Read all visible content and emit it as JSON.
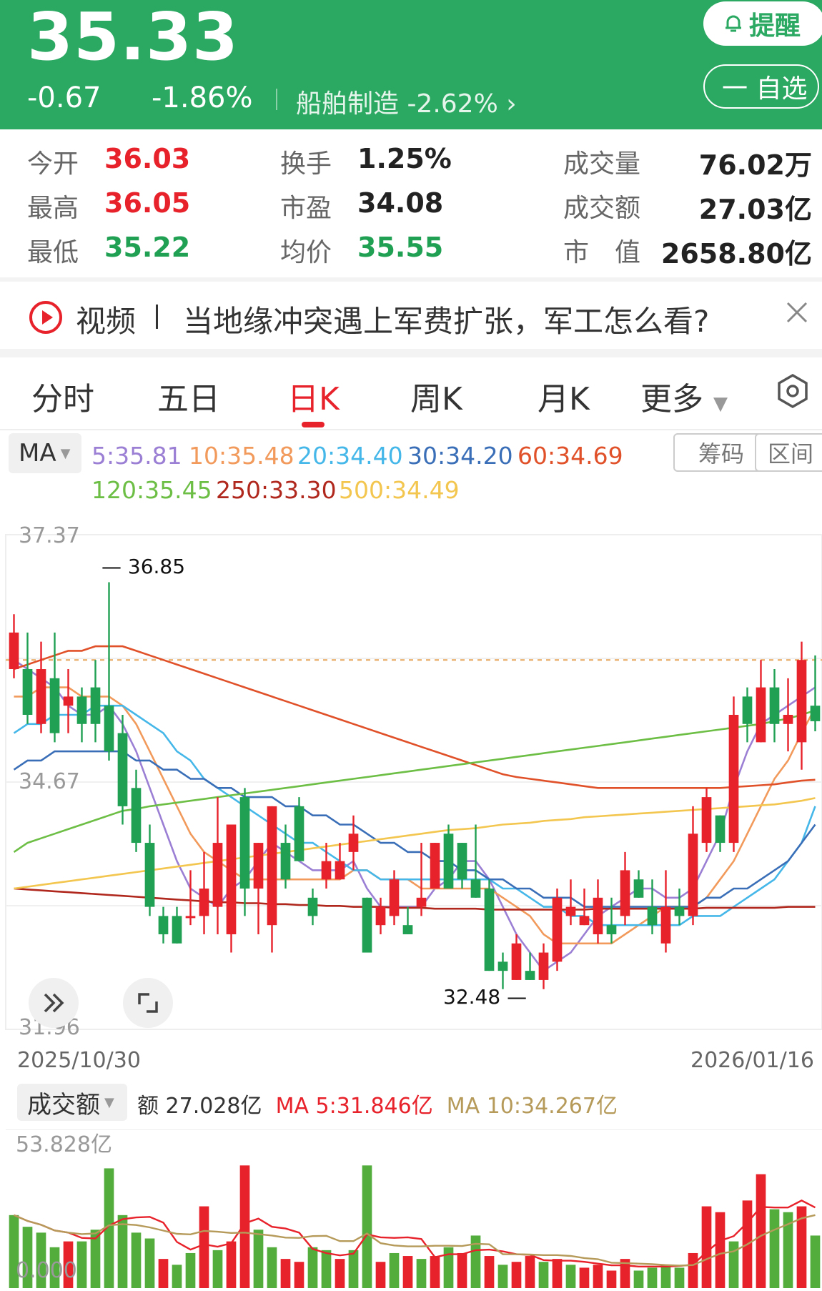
{
  "header": {
    "price": "35.33",
    "change": "-0.67",
    "change_pct": "-1.86%",
    "sector": "船舶制造  -2.62%",
    "alert_label": "提醒",
    "watch_label": "一 自选",
    "bg_color": "#2ba862"
  },
  "stats": {
    "open_label": "今开",
    "open": "36.03",
    "high_label": "最高",
    "high": "36.05",
    "low_label": "最低",
    "low": "35.22",
    "turnover_label": "换手",
    "turnover": "1.25%",
    "pe_label": "市盈",
    "pe": "34.08",
    "avg_label": "均价",
    "avg": "35.55",
    "volume_label": "成交量",
    "volume": "76.02万",
    "amount_label": "成交额",
    "amount": "27.03亿",
    "mktcap_label": "市　值",
    "mktcap": "2658.80亿"
  },
  "news": {
    "tag": "视频",
    "headline": "当地缘冲突遇上军费扩张，军工怎么看?"
  },
  "tabs": [
    "分时",
    "五日",
    "日K",
    "周K",
    "月K",
    "更多"
  ],
  "active_tab": "日K",
  "ma_legend": {
    "select": "MA",
    "items": [
      {
        "label": "5:35.81",
        "color": "#9b7fd4"
      },
      {
        "label": "10:35.48",
        "color": "#f19a5c"
      },
      {
        "label": "20:34.40",
        "color": "#45b7e8"
      },
      {
        "label": "30:34.20",
        "color": "#3a6fb8"
      },
      {
        "label": "60:34.69",
        "color": "#e0512a"
      },
      {
        "label": "120:35.45",
        "color": "#6cbe45"
      },
      {
        "label": "250:33.30",
        "color": "#b0281d"
      },
      {
        "label": "500:34.49",
        "color": "#f3c64f"
      }
    ],
    "chip_chips": "筹码",
    "chip_range": "区间"
  },
  "axis": {
    "y_top": "37.37",
    "y_mid": "34.67",
    "y_bottom": "31.96",
    "high_mark": "36.85",
    "low_mark": "32.48",
    "date_start": "2025/10/30",
    "date_end": "2026/01/16"
  },
  "volume": {
    "select": "成交额",
    "amount_text": "额 27.028亿",
    "ma5_text": "MA 5:31.846亿",
    "ma10_text": "MA 10:34.267亿",
    "y_top": "53.828亿",
    "y_bottom": "0.000"
  },
  "chart_data": {
    "type": "candlestick",
    "y_range": [
      31.96,
      37.37
    ],
    "candles": [
      [
        35.9,
        36.3,
        36.5,
        35.8
      ],
      [
        35.9,
        35.4,
        36.3,
        35.3
      ],
      [
        35.3,
        35.9,
        36.2,
        35.2
      ],
      [
        35.8,
        35.2,
        36.3,
        35.1
      ],
      [
        35.5,
        35.6,
        35.9,
        35.2
      ],
      [
        35.6,
        35.3,
        35.7,
        35.1
      ],
      [
        35.7,
        35.3,
        36.0,
        35.1
      ],
      [
        35.5,
        35.0,
        36.85,
        34.9
      ],
      [
        35.2,
        34.4,
        35.4,
        34.2
      ],
      [
        34.6,
        34.0,
        34.8,
        33.9
      ],
      [
        34.0,
        33.3,
        34.2,
        33.2
      ],
      [
        33.2,
        33.0,
        33.3,
        32.9
      ],
      [
        33.2,
        32.9,
        33.3,
        32.9
      ],
      [
        33.2,
        33.2,
        33.7,
        33.1
      ],
      [
        33.2,
        33.5,
        33.9,
        33.0
      ],
      [
        33.3,
        34.0,
        34.5,
        33.0
      ],
      [
        33.0,
        34.2,
        34.2,
        32.8
      ],
      [
        34.5,
        33.5,
        34.6,
        33.2
      ],
      [
        33.5,
        34.0,
        34.0,
        33.0
      ],
      [
        33.1,
        34.4,
        34.4,
        32.8
      ],
      [
        34.0,
        33.6,
        34.2,
        33.5
      ],
      [
        34.4,
        33.8,
        34.5,
        33.8
      ],
      [
        33.4,
        33.2,
        33.5,
        33.1
      ],
      [
        33.6,
        33.8,
        34.0,
        33.5
      ],
      [
        33.6,
        33.8,
        34.0,
        33.6
      ],
      [
        33.9,
        34.1,
        34.3,
        33.7
      ],
      [
        33.4,
        32.8,
        33.4,
        32.8
      ],
      [
        33.1,
        33.3,
        33.4,
        33.0
      ],
      [
        33.2,
        33.6,
        33.7,
        33.1
      ],
      [
        33.1,
        33.0,
        33.3,
        33.0
      ],
      [
        33.3,
        33.4,
        34.0,
        33.2
      ],
      [
        33.5,
        34.0,
        34.0,
        33.5
      ],
      [
        34.1,
        33.5,
        34.2,
        33.5
      ],
      [
        34.0,
        33.6,
        34.0,
        33.5
      ],
      [
        33.6,
        33.4,
        34.2,
        33.4
      ],
      [
        33.5,
        32.6,
        33.6,
        32.6
      ],
      [
        32.7,
        32.6,
        32.8,
        32.4
      ],
      [
        32.5,
        32.9,
        33.0,
        32.5
      ],
      [
        32.6,
        32.5,
        32.8,
        32.5
      ],
      [
        32.5,
        32.8,
        32.9,
        32.4
      ],
      [
        32.7,
        33.4,
        33.5,
        32.6
      ],
      [
        33.2,
        33.3,
        33.6,
        33.1
      ],
      [
        33.1,
        33.2,
        33.5,
        33.1
      ],
      [
        33.0,
        33.4,
        33.6,
        32.9
      ],
      [
        33.1,
        33.0,
        33.4,
        32.9
      ],
      [
        33.2,
        33.7,
        33.9,
        33.1
      ],
      [
        33.6,
        33.4,
        33.7,
        33.4
      ],
      [
        33.3,
        33.1,
        33.6,
        33.0
      ],
      [
        32.9,
        33.3,
        33.7,
        32.8
      ],
      [
        33.3,
        33.2,
        33.5,
        33.1
      ],
      [
        33.2,
        34.1,
        34.4,
        33.1
      ],
      [
        34.0,
        34.5,
        34.6,
        33.9
      ],
      [
        34.3,
        34.0,
        34.3,
        33.9
      ],
      [
        34.0,
        35.4,
        35.6,
        33.9
      ],
      [
        35.6,
        35.3,
        35.7,
        35.1
      ],
      [
        35.1,
        35.7,
        36.0,
        35.1
      ],
      [
        35.7,
        35.3,
        35.9,
        35.1
      ],
      [
        35.3,
        35.4,
        35.8,
        35.0
      ],
      [
        35.1,
        36.0,
        36.2,
        34.8
      ],
      [
        35.5,
        35.33,
        36.05,
        35.22
      ]
    ],
    "volume_y_range": [
      0,
      53.828
    ],
    "volume": [
      [
        25,
        "g"
      ],
      [
        21,
        "g"
      ],
      [
        19,
        "g"
      ],
      [
        14,
        "g"
      ],
      [
        16,
        "r"
      ],
      [
        16,
        "g"
      ],
      [
        20,
        "g"
      ],
      [
        41,
        "g"
      ],
      [
        25,
        "g"
      ],
      [
        19,
        "g"
      ],
      [
        17,
        "g"
      ],
      [
        10,
        "r"
      ],
      [
        8,
        "g"
      ],
      [
        12,
        "g"
      ],
      [
        28,
        "r"
      ],
      [
        13,
        "g"
      ],
      [
        16,
        "r"
      ],
      [
        42,
        "r"
      ],
      [
        20,
        "g"
      ],
      [
        14,
        "g"
      ],
      [
        10,
        "r"
      ],
      [
        9,
        "r"
      ],
      [
        14,
        "g"
      ],
      [
        13,
        "g"
      ],
      [
        10,
        "r"
      ],
      [
        13,
        "g"
      ],
      [
        42,
        "g"
      ],
      [
        9,
        "r"
      ],
      [
        12,
        "g"
      ],
      [
        11,
        "r"
      ],
      [
        10,
        "g"
      ],
      [
        11,
        "r"
      ],
      [
        14,
        "g"
      ],
      [
        12,
        "r"
      ],
      [
        18,
        "g"
      ],
      [
        11,
        "r"
      ],
      [
        8,
        "g"
      ],
      [
        9,
        "r"
      ],
      [
        11,
        "r"
      ],
      [
        9,
        "g"
      ],
      [
        10,
        "r"
      ],
      [
        8,
        "g"
      ],
      [
        7,
        "r"
      ],
      [
        8,
        "r"
      ],
      [
        6,
        "r"
      ],
      [
        10,
        "r"
      ],
      [
        6,
        "g"
      ],
      [
        7,
        "g"
      ],
      [
        8,
        "g"
      ],
      [
        7,
        "g"
      ],
      [
        12,
        "r"
      ],
      [
        28,
        "r"
      ],
      [
        26,
        "r"
      ],
      [
        16,
        "g"
      ],
      [
        30,
        "r"
      ],
      [
        39,
        "r"
      ],
      [
        27,
        "g"
      ],
      [
        26,
        "g"
      ],
      [
        28,
        "r"
      ],
      [
        18,
        "g"
      ]
    ],
    "ma_series": [
      {
        "name": "MA5",
        "color": "#9b7fd4",
        "values": [
          36.0,
          35.9,
          35.8,
          35.7,
          35.5,
          35.4,
          35.4,
          35.5,
          35.3,
          35.0,
          34.6,
          34.2,
          33.8,
          33.5,
          33.4,
          33.3,
          33.5,
          33.6,
          33.8,
          34.0,
          33.9,
          33.8,
          33.7,
          33.7,
          33.7,
          33.8,
          33.5,
          33.3,
          33.3,
          33.3,
          33.3,
          33.5,
          33.6,
          33.8,
          33.8,
          33.6,
          33.3,
          33.0,
          32.8,
          32.6,
          32.7,
          32.8,
          33.0,
          33.2,
          33.3,
          33.4,
          33.5,
          33.5,
          33.4,
          33.4,
          33.5,
          33.8,
          34.1,
          34.6,
          35.0,
          35.3,
          35.4,
          35.5,
          35.6,
          35.7
        ]
      },
      {
        "name": "MA10",
        "color": "#f19a5c",
        "values": [
          35.6,
          35.6,
          35.7,
          35.7,
          35.7,
          35.6,
          35.6,
          35.6,
          35.5,
          35.3,
          35.0,
          34.7,
          34.4,
          34.1,
          33.9,
          33.8,
          33.7,
          33.6,
          33.6,
          33.6,
          33.6,
          33.6,
          33.6,
          33.6,
          33.6,
          33.7,
          33.7,
          33.6,
          33.6,
          33.6,
          33.5,
          33.5,
          33.5,
          33.5,
          33.5,
          33.5,
          33.4,
          33.3,
          33.2,
          33.0,
          32.9,
          32.9,
          32.9,
          32.9,
          32.9,
          33.0,
          33.1,
          33.2,
          33.3,
          33.3,
          33.3,
          33.4,
          33.6,
          33.8,
          34.1,
          34.4,
          34.7,
          34.9,
          35.2,
          35.48
        ]
      },
      {
        "name": "MA20",
        "color": "#45b7e8",
        "values": [
          35.2,
          35.3,
          35.3,
          35.4,
          35.4,
          35.4,
          35.5,
          35.5,
          35.5,
          35.4,
          35.3,
          35.2,
          35.0,
          34.9,
          34.7,
          34.6,
          34.5,
          34.4,
          34.3,
          34.2,
          34.1,
          34.0,
          34.0,
          33.9,
          33.8,
          33.7,
          33.7,
          33.6,
          33.6,
          33.6,
          33.6,
          33.6,
          33.6,
          33.6,
          33.6,
          33.6,
          33.5,
          33.5,
          33.4,
          33.3,
          33.3,
          33.2,
          33.2,
          33.1,
          33.1,
          33.1,
          33.1,
          33.1,
          33.1,
          33.1,
          33.2,
          33.2,
          33.2,
          33.3,
          33.4,
          33.5,
          33.6,
          33.8,
          34.0,
          34.4
        ]
      },
      {
        "name": "MA30",
        "color": "#3a6fb8",
        "values": [
          34.8,
          34.9,
          34.9,
          35.0,
          35.0,
          35.0,
          35.0,
          35.0,
          35.0,
          34.9,
          34.9,
          34.8,
          34.8,
          34.7,
          34.7,
          34.6,
          34.6,
          34.5,
          34.5,
          34.5,
          34.4,
          34.4,
          34.3,
          34.3,
          34.2,
          34.2,
          34.1,
          34.0,
          34.0,
          33.9,
          33.9,
          33.8,
          33.8,
          33.7,
          33.7,
          33.6,
          33.6,
          33.5,
          33.5,
          33.4,
          33.4,
          33.4,
          33.3,
          33.3,
          33.3,
          33.3,
          33.3,
          33.3,
          33.3,
          33.3,
          33.3,
          33.4,
          33.4,
          33.5,
          33.5,
          33.6,
          33.7,
          33.8,
          34.0,
          34.2
        ]
      },
      {
        "name": "MA60",
        "color": "#e0512a",
        "values": [
          35.9,
          35.95,
          36.0,
          36.05,
          36.1,
          36.1,
          36.15,
          36.15,
          36.15,
          36.1,
          36.05,
          36.0,
          35.95,
          35.9,
          35.85,
          35.8,
          35.75,
          35.7,
          35.65,
          35.6,
          35.55,
          35.5,
          35.45,
          35.4,
          35.35,
          35.3,
          35.25,
          35.2,
          35.15,
          35.1,
          35.05,
          35.0,
          34.95,
          34.9,
          34.85,
          34.8,
          34.75,
          34.72,
          34.7,
          34.68,
          34.66,
          34.64,
          34.62,
          34.6,
          34.6,
          34.6,
          34.6,
          34.6,
          34.6,
          34.6,
          34.6,
          34.6,
          34.6,
          34.61,
          34.62,
          34.63,
          34.64,
          34.66,
          34.68,
          34.69
        ]
      },
      {
        "name": "MA120",
        "color": "#6cbe45",
        "values": [
          33.9,
          34.0,
          34.05,
          34.1,
          34.15,
          34.2,
          34.25,
          34.3,
          34.35,
          34.37,
          34.4,
          34.42,
          34.44,
          34.46,
          34.48,
          34.5,
          34.52,
          34.54,
          34.56,
          34.58,
          34.6,
          34.62,
          34.64,
          34.66,
          34.68,
          34.7,
          34.72,
          34.74,
          34.76,
          34.78,
          34.8,
          34.82,
          34.84,
          34.86,
          34.88,
          34.9,
          34.92,
          34.94,
          34.96,
          34.98,
          35.0,
          35.02,
          35.04,
          35.06,
          35.08,
          35.1,
          35.12,
          35.14,
          35.16,
          35.18,
          35.2,
          35.22,
          35.24,
          35.26,
          35.28,
          35.3,
          35.33,
          35.36,
          35.4,
          35.45
        ]
      },
      {
        "name": "MA250",
        "color": "#b0281d",
        "values": [
          33.5,
          33.49,
          33.48,
          33.47,
          33.46,
          33.45,
          33.44,
          33.43,
          33.42,
          33.41,
          33.4,
          33.39,
          33.38,
          33.37,
          33.36,
          33.35,
          33.35,
          33.34,
          33.34,
          33.33,
          33.33,
          33.32,
          33.32,
          33.31,
          33.31,
          33.3,
          33.3,
          33.3,
          33.29,
          33.29,
          33.29,
          33.28,
          33.28,
          33.28,
          33.28,
          33.27,
          33.27,
          33.27,
          33.27,
          33.27,
          33.27,
          33.27,
          33.27,
          33.28,
          33.28,
          33.28,
          33.28,
          33.28,
          33.28,
          33.28,
          33.28,
          33.29,
          33.29,
          33.29,
          33.29,
          33.29,
          33.29,
          33.3,
          33.3,
          33.3
        ]
      },
      {
        "name": "MA500",
        "color": "#f3c64f",
        "values": [
          33.5,
          33.52,
          33.54,
          33.56,
          33.58,
          33.6,
          33.62,
          33.64,
          33.66,
          33.68,
          33.7,
          33.72,
          33.74,
          33.76,
          33.78,
          33.8,
          33.82,
          33.84,
          33.86,
          33.88,
          33.9,
          33.92,
          33.94,
          33.96,
          33.98,
          34.0,
          34.02,
          34.04,
          34.06,
          34.08,
          34.1,
          34.12,
          34.14,
          34.15,
          34.16,
          34.18,
          34.2,
          34.21,
          34.22,
          34.24,
          34.25,
          34.26,
          34.28,
          34.29,
          34.3,
          34.31,
          34.32,
          34.33,
          34.34,
          34.35,
          34.36,
          34.37,
          34.38,
          34.39,
          34.4,
          34.41,
          34.42,
          34.44,
          34.46,
          34.49
        ]
      }
    ]
  }
}
